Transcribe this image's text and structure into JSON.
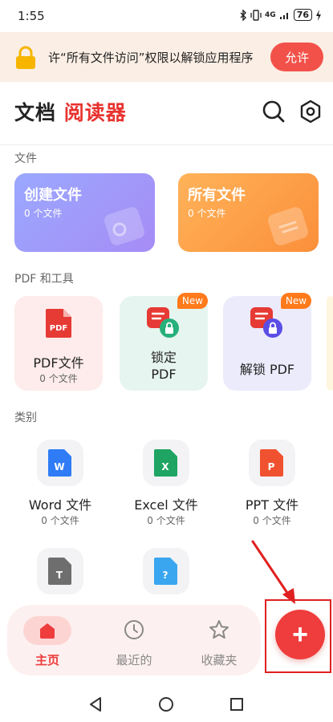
{
  "status_bar": {
    "time": "1:55",
    "icons": [
      "bluetooth-icon",
      "vibrate-icon",
      "signal-4g-icon",
      "wifi-icon"
    ],
    "network": "4G",
    "battery": "76"
  },
  "banner": {
    "text": "许“所有文件访问”权限以解锁应用程序",
    "allow_label": "允许"
  },
  "header": {
    "title_part1": "文档",
    "title_part2": "阅读器"
  },
  "sections": {
    "files": "文件",
    "tools": "PDF 和工具",
    "categories": "类别"
  },
  "cards": {
    "create": {
      "title": "创建文件",
      "sub": "0 个文件"
    },
    "all": {
      "title": "所有文件",
      "sub": "0 个文件"
    }
  },
  "tools": {
    "pdf": {
      "label": "PDF文件",
      "sub": "0 个文件"
    },
    "lock": {
      "label": "锁定\nPDF",
      "badge": "New"
    },
    "unlock": {
      "label": "解锁 PDF",
      "badge": "New"
    }
  },
  "categories": [
    {
      "label": "Word 文件",
      "sub": "0 个文件",
      "letter": "W",
      "color": "#2f7cf6"
    },
    {
      "label": "Excel 文件",
      "sub": "0 个文件",
      "letter": "X",
      "color": "#1fa463"
    },
    {
      "label": "PPT 文件",
      "sub": "0 个文件",
      "letter": "P",
      "color": "#f0522f"
    },
    {
      "label": "",
      "sub": "",
      "letter": "T",
      "color": "#6e6e6e"
    },
    {
      "label": "",
      "sub": "",
      "letter": "?",
      "color": "#3aa6f0"
    }
  ],
  "bottom_nav": {
    "home": "主页",
    "recent": "最近的",
    "favorites": "收藏夹"
  },
  "fab": {
    "symbol": "+"
  },
  "colors": {
    "accent": "#e8332f",
    "allow": "#f2514a",
    "fab": "#ef3c3c"
  }
}
